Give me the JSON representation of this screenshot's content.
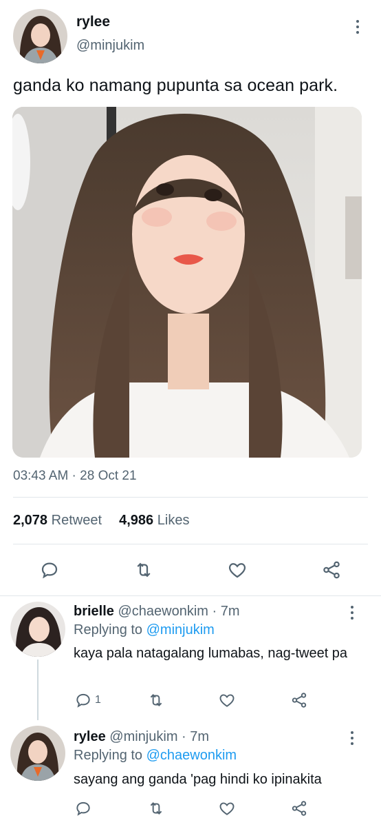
{
  "main_tweet": {
    "author_name": "rylee",
    "author_handle": "@minjukim",
    "text": "ganda ko namang pupunta sa ocean park.",
    "timestamp": "03:43 AM · 28 Oct 21",
    "retweet_count": "2,078",
    "retweet_label": "Retweet",
    "like_count": "4,986",
    "like_label": "Likes",
    "actions": [
      "reply-icon",
      "retweet-icon",
      "like-icon",
      "share-icon"
    ]
  },
  "replies": [
    {
      "author_name": "brielle",
      "author_handle": "@chaewonkim",
      "time": "· 7m",
      "replying_label": "Replying to",
      "replying_to": "@minjukim",
      "text": "kaya pala natagalang lumabas, nag-tweet pa",
      "reply_count": "1"
    },
    {
      "author_name": "rylee",
      "author_handle": "@minjukim",
      "time": "· 7m",
      "replying_label": "Replying to",
      "replying_to": "@chaewonkim",
      "text": "sayang ang ganda 'pag hindi ko ipinakita",
      "reply_count": ""
    }
  ],
  "colors": {
    "text": "#0f1419",
    "secondary": "#536471",
    "link": "#1d9bf0",
    "divider": "#e1e6ea"
  }
}
